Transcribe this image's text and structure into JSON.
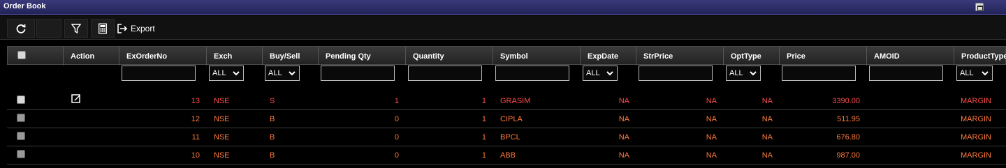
{
  "window": {
    "title": "Order Book"
  },
  "toolbar": {
    "export_label": "Export"
  },
  "table": {
    "columns": [
      {
        "key": "action",
        "label": "Action"
      },
      {
        "key": "exorderno",
        "label": "ExOrderNo"
      },
      {
        "key": "exch",
        "label": "Exch"
      },
      {
        "key": "buysell",
        "label": "Buy/Sell"
      },
      {
        "key": "pending",
        "label": "Pending Qty"
      },
      {
        "key": "qty",
        "label": "Quantity"
      },
      {
        "key": "symbol",
        "label": "Symbol"
      },
      {
        "key": "expdate",
        "label": "ExpDate"
      },
      {
        "key": "strprice",
        "label": "StrPrice"
      },
      {
        "key": "opttype",
        "label": "OptType"
      },
      {
        "key": "price",
        "label": "Price"
      },
      {
        "key": "amoid",
        "label": "AMOID"
      },
      {
        "key": "producttype",
        "label": "ProductType"
      }
    ],
    "filters": {
      "exch": "ALL",
      "buysell": "ALL",
      "expdate": "ALL",
      "opttype": "ALL",
      "producttype": "ALL"
    },
    "rows": [
      {
        "exorderno": "13",
        "exch": "NSE",
        "buysell": "S",
        "pending": "1",
        "qty": "1",
        "symbol": "GRASIM",
        "expdate": "NA",
        "strprice": "NA",
        "opttype": "NA",
        "price": "3390.00",
        "amoid": "",
        "producttype": "MARGIN"
      },
      {
        "exorderno": "12",
        "exch": "NSE",
        "buysell": "B",
        "pending": "0",
        "qty": "1",
        "symbol": "CIPLA",
        "expdate": "NA",
        "strprice": "NA",
        "opttype": "NA",
        "price": "511.95",
        "amoid": "",
        "producttype": "MARGIN"
      },
      {
        "exorderno": "11",
        "exch": "NSE",
        "buysell": "B",
        "pending": "0",
        "qty": "1",
        "symbol": "BPCL",
        "expdate": "NA",
        "strprice": "NA",
        "opttype": "NA",
        "price": "676.80",
        "amoid": "",
        "producttype": "MARGIN"
      },
      {
        "exorderno": "10",
        "exch": "NSE",
        "buysell": "B",
        "pending": "0",
        "qty": "1",
        "symbol": "ABB",
        "expdate": "NA",
        "strprice": "NA",
        "opttype": "NA",
        "price": "987.00",
        "amoid": "",
        "producttype": "MARGIN"
      }
    ]
  },
  "colors": {
    "open_order": "#ff4b4b",
    "completed_order": "#ff7a3c",
    "title_bar": "#2b2b6a"
  }
}
